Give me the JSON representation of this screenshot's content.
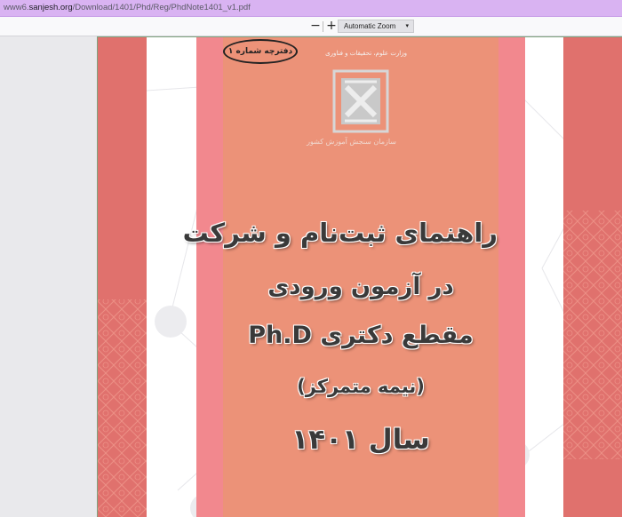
{
  "browser": {
    "url_prefix": "www6.",
    "url_domain": "sanjesh.org",
    "url_path": "/Download/1401/Phd/Reg/PhdNote1401_v1.pdf"
  },
  "pdf_toolbar": {
    "zoom_out_label": "−",
    "zoom_in_label": "+",
    "zoom_selected": "Automatic Zoom",
    "zoom_caret": "▾"
  },
  "cover": {
    "booklet_label": "دفترچه شماره ۱",
    "ministry_text": "وزارت علوم، تحقیقات و فناوری",
    "org_name": "سازمان سنجش آموزش کشور",
    "title_line1": "راهنمای ثبت‌نام و شرکت",
    "title_line2": "در آزمون ورودی",
    "title_line3": "مقطع دکتری Ph.D",
    "title_line4": "(نیمه متمرکز)",
    "title_line5": "سال ۱۴۰۱",
    "colors": {
      "cover_bg": "#ec9278",
      "pink_band": "#f2888e",
      "outer_band": "#e0716d",
      "accent": "#d9b3f2"
    }
  }
}
